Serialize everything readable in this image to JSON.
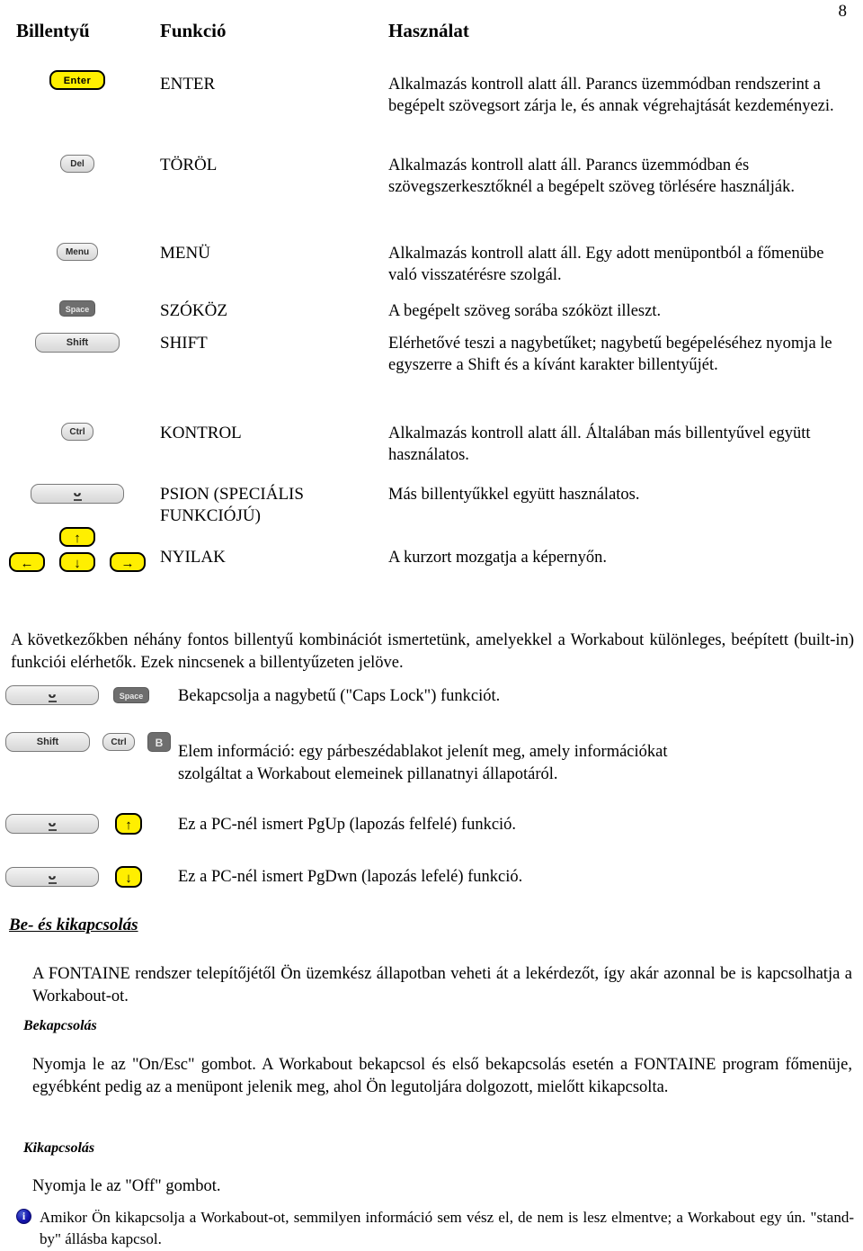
{
  "page": {
    "number": "8"
  },
  "table": {
    "headers": {
      "key": "Billentyű",
      "function": "Funkció",
      "usage": "Használat"
    },
    "rows": [
      {
        "key_label": "Enter",
        "function": "ENTER",
        "usage": "Alkalmazás kontroll alatt áll. Parancs üzemmódban rendszerint a begépelt szövegsort zárja le, és annak végrehajtását kezdeményezi."
      },
      {
        "key_label": "Del",
        "function": "TÖRÖL",
        "usage": "Alkalmazás kontroll alatt áll. Parancs üzemmódban és szövegszerkesztőknél a begépelt szöveg törlésére használják."
      },
      {
        "key_label": "Menu",
        "function": "MENÜ",
        "usage": "Alkalmazás kontroll alatt áll. Egy adott menüpontból a főmenübe való visszatérésre szolgál."
      },
      {
        "key_label": "Space",
        "function": "SZÓKÖZ",
        "usage": "A begépelt szöveg sorába szóközt illeszt."
      },
      {
        "key_label": "Shift",
        "function": "SHIFT",
        "usage": "Elérhetővé teszi a nagybetűket; nagybetű begépeléséhez nyomja le egyszerre a Shift és a kívánt karakter billentyűjét."
      },
      {
        "key_label": "Ctrl",
        "function": "KONTROL",
        "usage": "Alkalmazás kontroll alatt áll. Általában más billentyűvel együtt használatos."
      },
      {
        "key_label": "",
        "function": "PSION (SPECIÁLIS FUNKCIÓJÚ)",
        "usage": "Más billentyűkkel együtt használatos."
      },
      {
        "key_label": "",
        "function": "NYILAK",
        "usage": "A kurzort mozgatja a képernyőn."
      }
    ]
  },
  "intro_paragraph": "A következőkben néhány fontos billentyű kombinációt ismertetünk, amelyekkel a Workabout különleges, beépített (built-in) funkciói elérhetők. Ezek nincsenek a billentyűzeten jelöve.",
  "combinations": [
    {
      "keys": [
        "psion",
        "Space"
      ],
      "description": "Bekapcsolja a nagybetű (\"Caps Lock\") funkciót."
    },
    {
      "keys": [
        "Shift",
        "Ctrl",
        "B"
      ],
      "description": "Elem információ: egy párbeszédablakot jelenít meg, amely információkat szolgáltat a Workabout elemeinek pillanatnyi állapotáról."
    },
    {
      "keys": [
        "psion",
        "arrow-up"
      ],
      "description": "Ez a PC-nél ismert PgUp (lapozás felfelé) funkció."
    },
    {
      "keys": [
        "psion",
        "arrow-down"
      ],
      "description": "Ez a PC-nél ismert PgDwn (lapozás lefelé) funkció."
    }
  ],
  "power_section": {
    "title": "Be- és kikapcsolás",
    "intro": "A FONTAINE rendszer telepítőjétől Ön üzemkész állapotban veheti át a lekérdezőt, így akár azonnal be is kapcsolhatja a Workabout-ot.",
    "on_title": "Bekapcsolás",
    "on_text": "Nyomja le az \"On/Esc\" gombot. A Workabout bekapcsol és első bekapcsolás esetén a FONTAINE program főmenüje, egyébként pedig az a menüpont jelenik meg, ahol Ön legutoljára dolgozott, mielőtt kikapcsolta.",
    "off_title": "Kikapcsolás",
    "off_text": "Nyomja le az \"Off\" gombot.",
    "note": "Amikor Ön kikapcsolja a Workabout-ot, semmilyen információ sem vész el, de nem is lesz elmentve; a Workabout egy ún. \"stand-by\" állásba kapcsol."
  },
  "icons": {
    "info": "i",
    "arrow_up": "↑",
    "arrow_down": "↓",
    "arrow_left": "←",
    "arrow_right": "→",
    "psion_glyph": "ᴗ"
  },
  "colors": {
    "key_yellow": "#ffef00",
    "key_dark": "#6e6e6e",
    "info_blue": "#1616b0"
  }
}
